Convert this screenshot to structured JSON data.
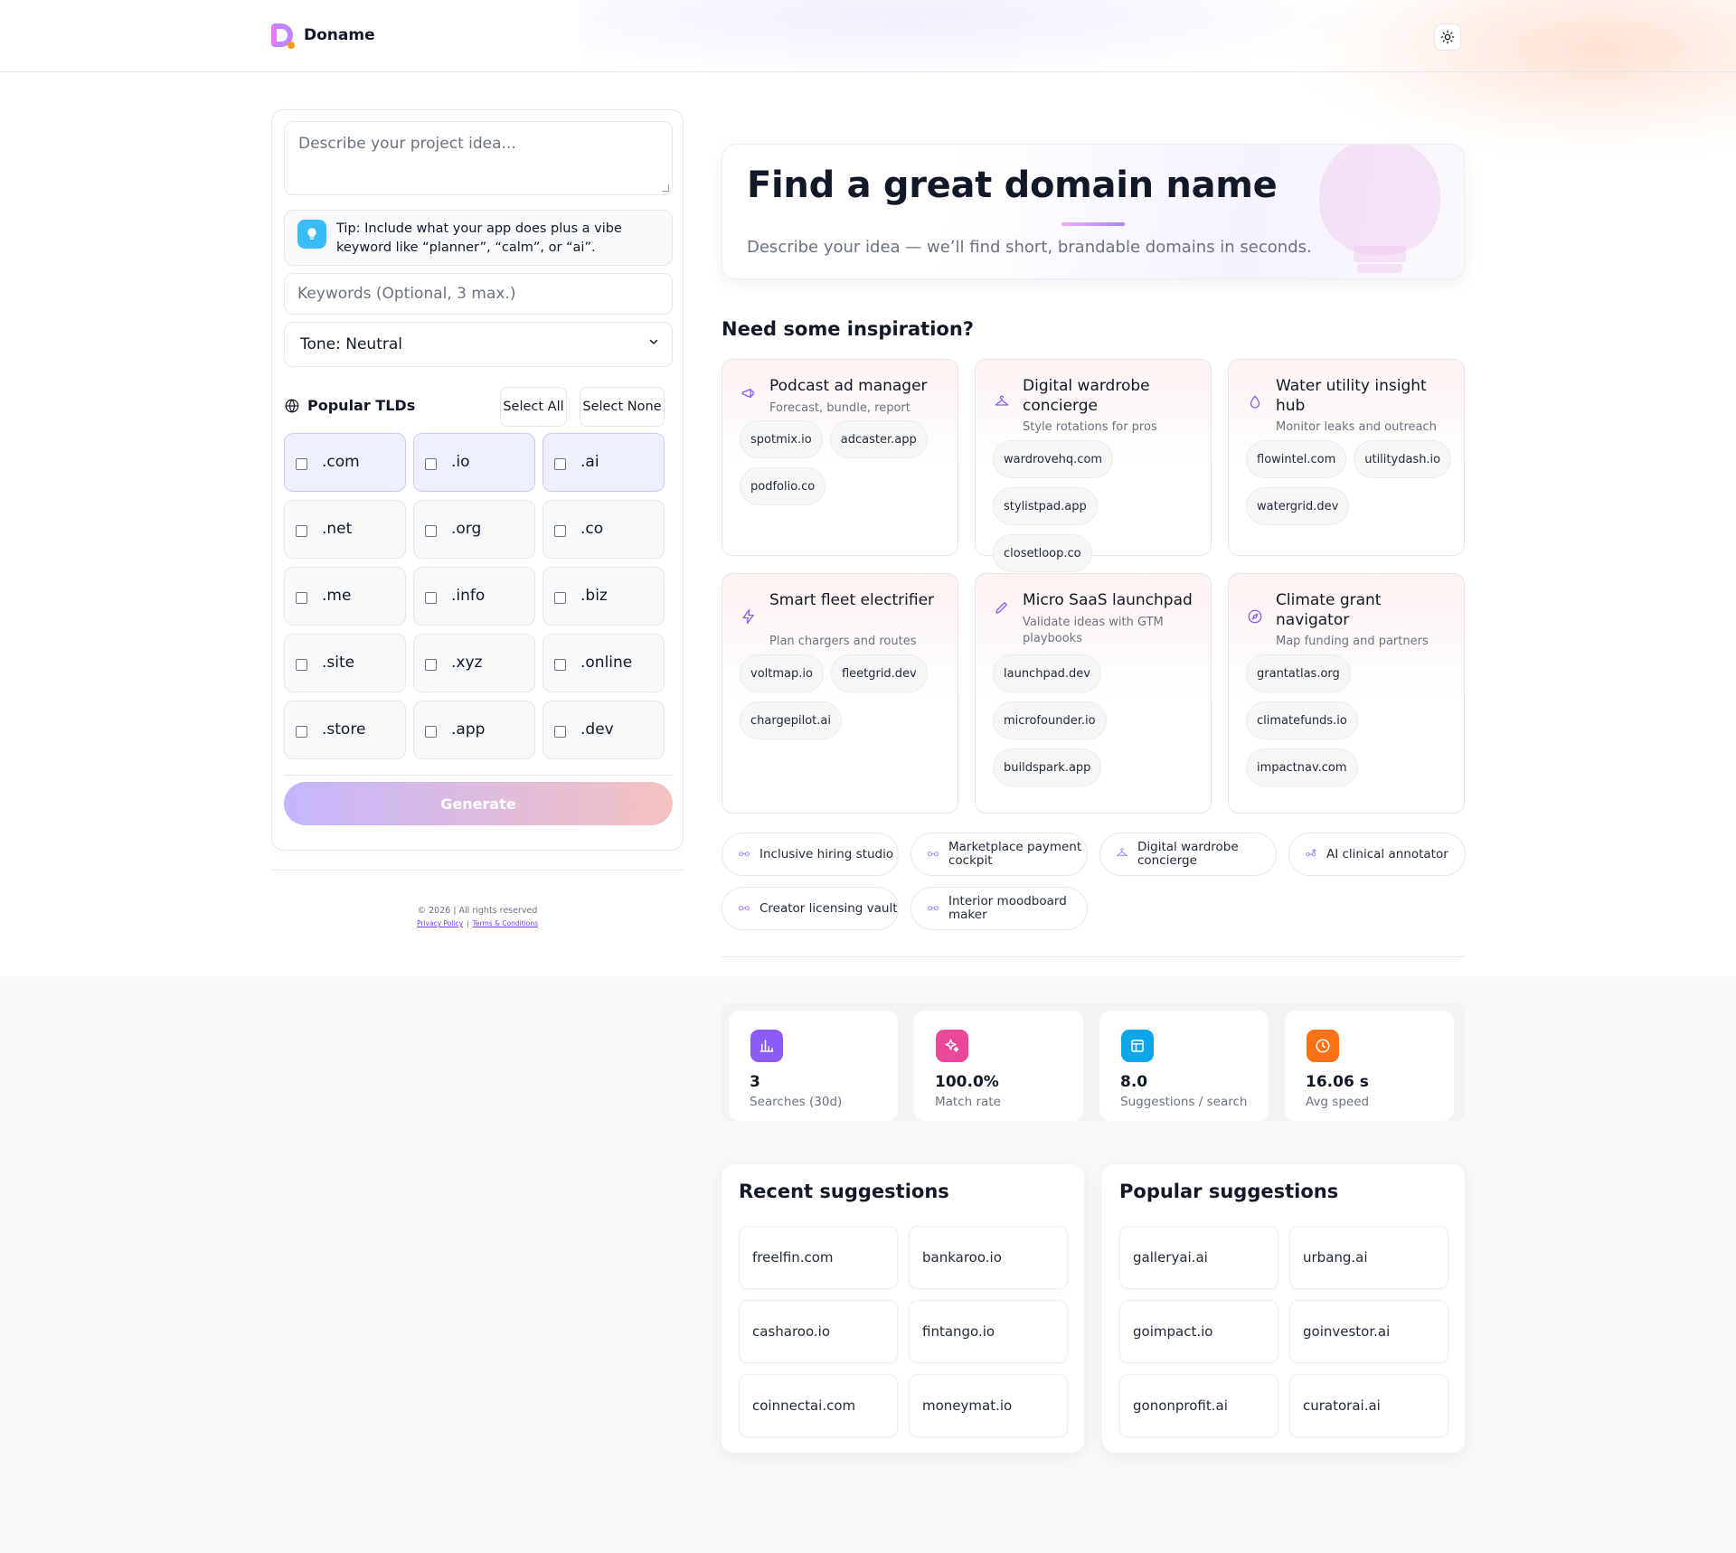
{
  "app": {
    "name": "Doname"
  },
  "form": {
    "idea_placeholder": "Describe your project idea...",
    "tip": "Tip: Include what your app does plus a vibe keyword like “planner”, “calm”, or “ai”.",
    "keywords_placeholder": "Keywords (Optional, 3 max.)",
    "tone": "Tone: Neutral",
    "tlds_title": "Popular TLDs",
    "select_all": "Select All",
    "select_none": "Select None",
    "tlds": [
      {
        "label": ".com",
        "highlighted": true
      },
      {
        "label": ".io",
        "highlighted": true
      },
      {
        "label": ".ai",
        "highlighted": true
      },
      {
        "label": ".net",
        "highlighted": false
      },
      {
        "label": ".org",
        "highlighted": false
      },
      {
        "label": ".co",
        "highlighted": false
      },
      {
        "label": ".me",
        "highlighted": false
      },
      {
        "label": ".info",
        "highlighted": false
      },
      {
        "label": ".biz",
        "highlighted": false
      },
      {
        "label": ".site",
        "highlighted": false
      },
      {
        "label": ".xyz",
        "highlighted": false
      },
      {
        "label": ".online",
        "highlighted": false
      },
      {
        "label": ".store",
        "highlighted": false
      },
      {
        "label": ".app",
        "highlighted": false
      },
      {
        "label": ".dev",
        "highlighted": false
      }
    ],
    "generate": "Generate"
  },
  "footer": {
    "copyright": "© 2026 | All rights reserved",
    "privacy": "Privacy Policy",
    "terms": "Terms & Conditions"
  },
  "hero": {
    "title": "Find a great domain name",
    "subtitle": "Describe your idea — we’ll find short, brandable domains in seconds."
  },
  "inspiration": {
    "title": "Need some inspiration?",
    "cards": [
      {
        "title": "Podcast ad manager",
        "subtitle": "Forecast, bundle, report",
        "icon": "megaphone-icon",
        "chips": [
          "spotmix.io",
          "adcaster.app",
          "podfolio.co"
        ]
      },
      {
        "title": "Digital wardrobe concierge",
        "subtitle": "Style rotations for pros",
        "icon": "hanger-icon",
        "chips": [
          "wardrovehq.com",
          "stylistpad.app",
          "closetloop.co"
        ]
      },
      {
        "title": "Water utility insight hub",
        "subtitle": "Monitor leaks and outreach",
        "icon": "droplet-icon",
        "chips": [
          "flowintel.com",
          "utilitydash.io",
          "watergrid.dev"
        ]
      },
      {
        "title": "Smart fleet electrifier",
        "subtitle": "Plan chargers and routes",
        "icon": "lightning-icon",
        "chips": [
          "voltmap.io",
          "fleetgrid.dev",
          "chargepilot.ai"
        ]
      },
      {
        "title": "Micro SaaS launchpad",
        "subtitle": "Validate ideas with GTM playbooks",
        "icon": "pencil-icon",
        "chips": [
          "launchpad.dev",
          "microfounder.io",
          "buildspark.app"
        ]
      },
      {
        "title": "Climate grant navigator",
        "subtitle": "Map funding and partners",
        "icon": "compass-icon",
        "chips": [
          "grantatlas.org",
          "climatefunds.io",
          "impactnav.com"
        ]
      }
    ],
    "pills": [
      {
        "label": "Inclusive hiring studio",
        "icon": "glasses-icon"
      },
      {
        "label": "Marketplace payment cockpit",
        "icon": "glasses-icon"
      },
      {
        "label": "Digital wardrobe concierge",
        "icon": "hanger-icon"
      },
      {
        "label": "AI clinical annotator",
        "icon": "sparkle-glasses-icon"
      },
      {
        "label": "Creator licensing vault",
        "icon": "glasses-icon"
      },
      {
        "label": "Interior moodboard maker",
        "icon": "glasses-icon"
      }
    ]
  },
  "stats": [
    {
      "value": "3",
      "label": "Searches (30d)",
      "icon": "bar-chart-icon",
      "color": "#8b5cf6"
    },
    {
      "value": "100.0%",
      "label": "Match rate",
      "icon": "sparkles-icon",
      "color": "#ec4899"
    },
    {
      "value": "8.0",
      "label": "Suggestions / search",
      "icon": "layout-icon",
      "color": "#0ea5e9"
    },
    {
      "value": "16.06 s",
      "label": "Avg speed",
      "icon": "clock-icon",
      "color": "#f97316"
    }
  ],
  "recent": {
    "title": "Recent suggestions",
    "items": [
      "freelfin.com",
      "bankaroo.io",
      "casharoo.io",
      "fintango.io",
      "coinnectai.com",
      "moneymat.io"
    ]
  },
  "popular": {
    "title": "Popular suggestions",
    "items": [
      "galleryai.ai",
      "urbang.ai",
      "goimpact.io",
      "goinvestor.ai",
      "gononprofit.ai",
      "curatorai.ai"
    ]
  }
}
